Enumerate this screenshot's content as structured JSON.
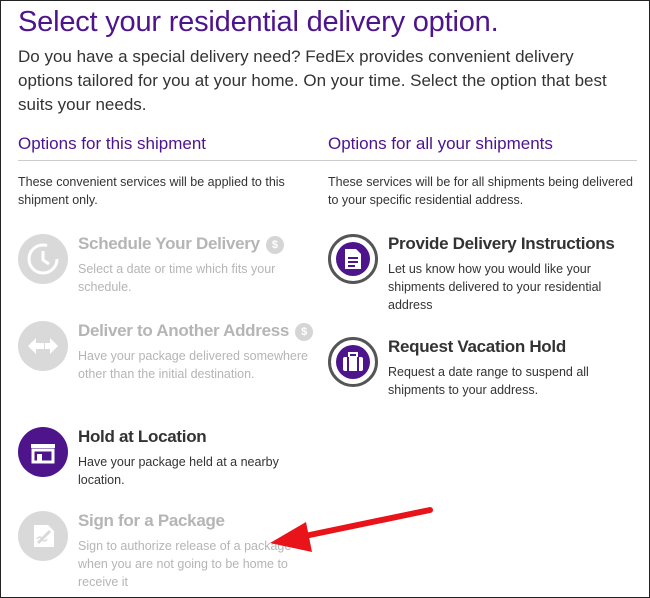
{
  "page": {
    "title": "Select your residential delivery option.",
    "intro": "Do you have a special delivery need? FedEx provides convenient delivery options tailored for you at your home. On your time. Select the option that best suits your needs."
  },
  "left": {
    "heading": "Options for this shipment",
    "description": "These convenient services will be applied to this shipment only.",
    "options": [
      {
        "name": "Schedule Your Delivery",
        "fee": "$",
        "desc": "Select a date or time which fits your schedule.",
        "icon": "clock-icon",
        "enabled": false
      },
      {
        "name": "Deliver to Another Address",
        "fee": "$",
        "desc": "Have your package delivered somewhere other than the initial destination.",
        "icon": "redirect-arrows-icon",
        "enabled": false
      },
      {
        "name": "Hold at Location",
        "desc": "Have your package held at a nearby location.",
        "icon": "storefront-icon",
        "enabled": true
      },
      {
        "name": "Sign for a Package",
        "desc": "Sign to authorize release of a package when you are not going to be home to receive it",
        "icon": "signature-icon",
        "enabled": false
      }
    ]
  },
  "right": {
    "heading": "Options for all your shipments",
    "description": "These services will be for all shipments being delivered to your specific residential address.",
    "options": [
      {
        "name": "Provide Delivery Instructions",
        "desc": "Let us know how you would like your shipments delivered to your residential address",
        "icon": "document-icon",
        "enabled": true
      },
      {
        "name": "Request Vacation Hold",
        "desc": "Request a date range to suspend all shipments to your address.",
        "icon": "suitcase-icon",
        "enabled": true
      }
    ]
  },
  "colors": {
    "brand_purple": "#4d148c",
    "disabled_gray": "#b5b5b5",
    "arrow_red": "#e8141a"
  }
}
